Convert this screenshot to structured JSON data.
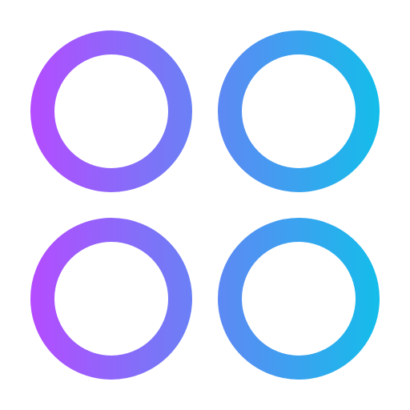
{
  "icon": {
    "name": "grid-circles-icon",
    "gradient": {
      "start_color": "#b44cff",
      "end_color": "#14bdea",
      "direction": "left-to-right"
    },
    "background_color": "#ffffff",
    "rings": [
      {
        "name": "ring-top-left"
      },
      {
        "name": "ring-top-right"
      },
      {
        "name": "ring-bottom-left"
      },
      {
        "name": "ring-bottom-right"
      }
    ]
  }
}
